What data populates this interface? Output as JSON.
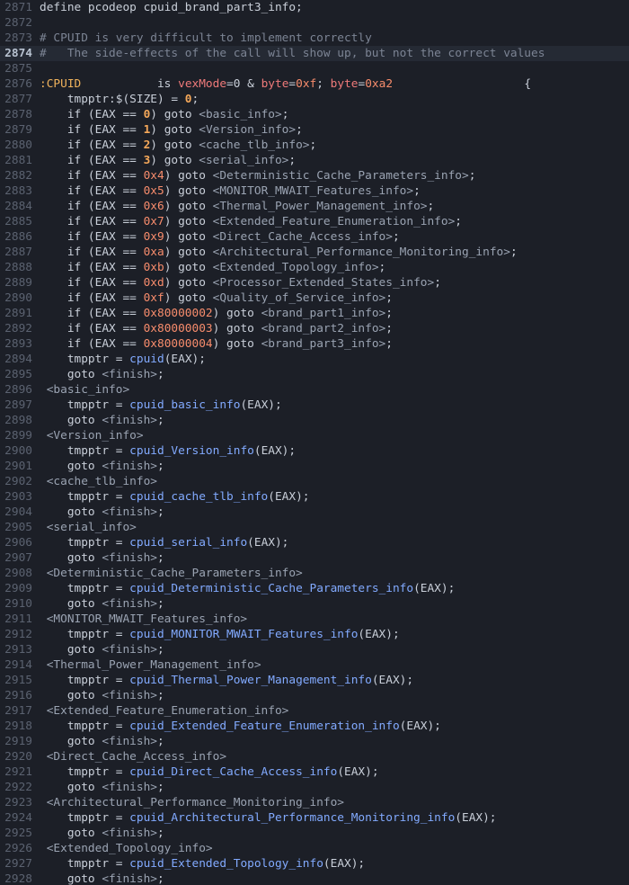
{
  "lines": [
    {
      "n": "2871",
      "t": [
        [
          "kw",
          "define pcodeop cpuid_brand_part3_info;"
        ]
      ]
    },
    {
      "n": "2872",
      "t": []
    },
    {
      "n": "2873",
      "t": [
        [
          "cm",
          "# CPUID is very difficult to implement correctly"
        ]
      ]
    },
    {
      "n": "2874",
      "current": true,
      "t": [
        [
          "cm",
          "#   The side-effects of the call will show up, but not the correct values"
        ]
      ]
    },
    {
      "n": "2875",
      "t": []
    },
    {
      "n": "2876",
      "t": [
        [
          "lbl",
          ":CPUID"
        ],
        [
          "pl",
          "           is "
        ],
        [
          "red",
          "vexMode"
        ],
        [
          "pl",
          "=0 & "
        ],
        [
          "red",
          "byte"
        ],
        [
          "pl",
          "="
        ],
        [
          "num",
          "0xf"
        ],
        [
          "pl",
          "; "
        ],
        [
          "red",
          "byte"
        ],
        [
          "pl",
          "="
        ],
        [
          "num",
          "0xa2"
        ],
        [
          "pl",
          "                   {"
        ]
      ]
    },
    {
      "n": "2877",
      "t": [
        [
          "pl",
          "    tmpptr:$(SIZE) = "
        ],
        [
          "numb",
          "0"
        ],
        [
          "pl",
          ";"
        ]
      ]
    },
    {
      "n": "2878",
      "t": [
        [
          "pl",
          "    if (EAX == "
        ],
        [
          "numb",
          "0"
        ],
        [
          "pl",
          ") goto "
        ],
        [
          "lb",
          "<basic_info>"
        ],
        [
          "pl",
          ";"
        ]
      ]
    },
    {
      "n": "2879",
      "t": [
        [
          "pl",
          "    if (EAX == "
        ],
        [
          "numb",
          "1"
        ],
        [
          "pl",
          ") goto "
        ],
        [
          "lb",
          "<Version_info>"
        ],
        [
          "pl",
          ";"
        ]
      ]
    },
    {
      "n": "2880",
      "t": [
        [
          "pl",
          "    if (EAX == "
        ],
        [
          "numb",
          "2"
        ],
        [
          "pl",
          ") goto "
        ],
        [
          "lb",
          "<cache_tlb_info>"
        ],
        [
          "pl",
          ";"
        ]
      ]
    },
    {
      "n": "2881",
      "t": [
        [
          "pl",
          "    if (EAX == "
        ],
        [
          "numb",
          "3"
        ],
        [
          "pl",
          ") goto "
        ],
        [
          "lb",
          "<serial_info>"
        ],
        [
          "pl",
          ";"
        ]
      ]
    },
    {
      "n": "2882",
      "t": [
        [
          "pl",
          "    if (EAX == "
        ],
        [
          "num",
          "0x4"
        ],
        [
          "pl",
          ") goto "
        ],
        [
          "lb",
          "<Deterministic_Cache_Parameters_info>"
        ],
        [
          "pl",
          ";"
        ]
      ]
    },
    {
      "n": "2883",
      "t": [
        [
          "pl",
          "    if (EAX == "
        ],
        [
          "num",
          "0x5"
        ],
        [
          "pl",
          ") goto "
        ],
        [
          "lb",
          "<MONITOR_MWAIT_Features_info>"
        ],
        [
          "pl",
          ";"
        ]
      ]
    },
    {
      "n": "2884",
      "t": [
        [
          "pl",
          "    if (EAX == "
        ],
        [
          "num",
          "0x6"
        ],
        [
          "pl",
          ") goto "
        ],
        [
          "lb",
          "<Thermal_Power_Management_info>"
        ],
        [
          "pl",
          ";"
        ]
      ]
    },
    {
      "n": "2885",
      "t": [
        [
          "pl",
          "    if (EAX == "
        ],
        [
          "num",
          "0x7"
        ],
        [
          "pl",
          ") goto "
        ],
        [
          "lb",
          "<Extended_Feature_Enumeration_info>"
        ],
        [
          "pl",
          ";"
        ]
      ]
    },
    {
      "n": "2886",
      "t": [
        [
          "pl",
          "    if (EAX == "
        ],
        [
          "num",
          "0x9"
        ],
        [
          "pl",
          ") goto "
        ],
        [
          "lb",
          "<Direct_Cache_Access_info>"
        ],
        [
          "pl",
          ";"
        ]
      ]
    },
    {
      "n": "2887",
      "t": [
        [
          "pl",
          "    if (EAX == "
        ],
        [
          "num",
          "0xa"
        ],
        [
          "pl",
          ") goto "
        ],
        [
          "lb",
          "<Architectural_Performance_Monitoring_info>"
        ],
        [
          "pl",
          ";"
        ]
      ]
    },
    {
      "n": "2888",
      "t": [
        [
          "pl",
          "    if (EAX == "
        ],
        [
          "num",
          "0xb"
        ],
        [
          "pl",
          ") goto "
        ],
        [
          "lb",
          "<Extended_Topology_info>"
        ],
        [
          "pl",
          ";"
        ]
      ]
    },
    {
      "n": "2889",
      "t": [
        [
          "pl",
          "    if (EAX == "
        ],
        [
          "num",
          "0xd"
        ],
        [
          "pl",
          ") goto "
        ],
        [
          "lb",
          "<Processor_Extended_States_info>"
        ],
        [
          "pl",
          ";"
        ]
      ]
    },
    {
      "n": "2890",
      "t": [
        [
          "pl",
          "    if (EAX == "
        ],
        [
          "num",
          "0xf"
        ],
        [
          "pl",
          ") goto "
        ],
        [
          "lb",
          "<Quality_of_Service_info>"
        ],
        [
          "pl",
          ";"
        ]
      ]
    },
    {
      "n": "2891",
      "t": [
        [
          "pl",
          "    if (EAX == "
        ],
        [
          "num",
          "0x80000002"
        ],
        [
          "pl",
          ") goto "
        ],
        [
          "lb",
          "<brand_part1_info>"
        ],
        [
          "pl",
          ";"
        ]
      ]
    },
    {
      "n": "2892",
      "t": [
        [
          "pl",
          "    if (EAX == "
        ],
        [
          "num",
          "0x80000003"
        ],
        [
          "pl",
          ") goto "
        ],
        [
          "lb",
          "<brand_part2_info>"
        ],
        [
          "pl",
          ";"
        ]
      ]
    },
    {
      "n": "2893",
      "t": [
        [
          "pl",
          "    if (EAX == "
        ],
        [
          "num",
          "0x80000004"
        ],
        [
          "pl",
          ") goto "
        ],
        [
          "lb",
          "<brand_part3_info>"
        ],
        [
          "pl",
          ";"
        ]
      ]
    },
    {
      "n": "2894",
      "t": [
        [
          "pl",
          "    tmpptr = "
        ],
        [
          "fn",
          "cpuid"
        ],
        [
          "pl",
          "(EAX);"
        ]
      ]
    },
    {
      "n": "2895",
      "t": [
        [
          "pl",
          "    goto "
        ],
        [
          "lb",
          "<finish>"
        ],
        [
          "pl",
          ";"
        ]
      ]
    },
    {
      "n": "2896",
      "t": [
        [
          "lb",
          " <basic_info>"
        ]
      ]
    },
    {
      "n": "2897",
      "t": [
        [
          "pl",
          "    tmpptr = "
        ],
        [
          "fn",
          "cpuid_basic_info"
        ],
        [
          "pl",
          "(EAX);"
        ]
      ]
    },
    {
      "n": "2898",
      "t": [
        [
          "pl",
          "    goto "
        ],
        [
          "lb",
          "<finish>"
        ],
        [
          "pl",
          ";"
        ]
      ]
    },
    {
      "n": "2899",
      "t": [
        [
          "lb",
          " <Version_info>"
        ]
      ]
    },
    {
      "n": "2900",
      "t": [
        [
          "pl",
          "    tmpptr = "
        ],
        [
          "fn",
          "cpuid_Version_info"
        ],
        [
          "pl",
          "(EAX);"
        ]
      ]
    },
    {
      "n": "2901",
      "t": [
        [
          "pl",
          "    goto "
        ],
        [
          "lb",
          "<finish>"
        ],
        [
          "pl",
          ";"
        ]
      ]
    },
    {
      "n": "2902",
      "t": [
        [
          "lb",
          " <cache_tlb_info>"
        ]
      ]
    },
    {
      "n": "2903",
      "t": [
        [
          "pl",
          "    tmpptr = "
        ],
        [
          "fn",
          "cpuid_cache_tlb_info"
        ],
        [
          "pl",
          "(EAX);"
        ]
      ]
    },
    {
      "n": "2904",
      "t": [
        [
          "pl",
          "    goto "
        ],
        [
          "lb",
          "<finish>"
        ],
        [
          "pl",
          ";"
        ]
      ]
    },
    {
      "n": "2905",
      "t": [
        [
          "lb",
          " <serial_info>"
        ]
      ]
    },
    {
      "n": "2906",
      "t": [
        [
          "pl",
          "    tmpptr = "
        ],
        [
          "fn",
          "cpuid_serial_info"
        ],
        [
          "pl",
          "(EAX);"
        ]
      ]
    },
    {
      "n": "2907",
      "t": [
        [
          "pl",
          "    goto "
        ],
        [
          "lb",
          "<finish>"
        ],
        [
          "pl",
          ";"
        ]
      ]
    },
    {
      "n": "2908",
      "t": [
        [
          "lb",
          " <Deterministic_Cache_Parameters_info>"
        ]
      ]
    },
    {
      "n": "2909",
      "t": [
        [
          "pl",
          "    tmpptr = "
        ],
        [
          "fn",
          "cpuid_Deterministic_Cache_Parameters_info"
        ],
        [
          "pl",
          "(EAX);"
        ]
      ]
    },
    {
      "n": "2910",
      "t": [
        [
          "pl",
          "    goto "
        ],
        [
          "lb",
          "<finish>"
        ],
        [
          "pl",
          ";"
        ]
      ]
    },
    {
      "n": "2911",
      "t": [
        [
          "lb",
          " <MONITOR_MWAIT_Features_info>"
        ]
      ]
    },
    {
      "n": "2912",
      "t": [
        [
          "pl",
          "    tmpptr = "
        ],
        [
          "fn",
          "cpuid_MONITOR_MWAIT_Features_info"
        ],
        [
          "pl",
          "(EAX);"
        ]
      ]
    },
    {
      "n": "2913",
      "t": [
        [
          "pl",
          "    goto "
        ],
        [
          "lb",
          "<finish>"
        ],
        [
          "pl",
          ";"
        ]
      ]
    },
    {
      "n": "2914",
      "t": [
        [
          "lb",
          " <Thermal_Power_Management_info>"
        ]
      ]
    },
    {
      "n": "2915",
      "t": [
        [
          "pl",
          "    tmpptr = "
        ],
        [
          "fn",
          "cpuid_Thermal_Power_Management_info"
        ],
        [
          "pl",
          "(EAX);"
        ]
      ]
    },
    {
      "n": "2916",
      "t": [
        [
          "pl",
          "    goto "
        ],
        [
          "lb",
          "<finish>"
        ],
        [
          "pl",
          ";"
        ]
      ]
    },
    {
      "n": "2917",
      "t": [
        [
          "lb",
          " <Extended_Feature_Enumeration_info>"
        ]
      ]
    },
    {
      "n": "2918",
      "t": [
        [
          "pl",
          "    tmpptr = "
        ],
        [
          "fn",
          "cpuid_Extended_Feature_Enumeration_info"
        ],
        [
          "pl",
          "(EAX);"
        ]
      ]
    },
    {
      "n": "2919",
      "t": [
        [
          "pl",
          "    goto "
        ],
        [
          "lb",
          "<finish>"
        ],
        [
          "pl",
          ";"
        ]
      ]
    },
    {
      "n": "2920",
      "t": [
        [
          "lb",
          " <Direct_Cache_Access_info>"
        ]
      ]
    },
    {
      "n": "2921",
      "t": [
        [
          "pl",
          "    tmpptr = "
        ],
        [
          "fn",
          "cpuid_Direct_Cache_Access_info"
        ],
        [
          "pl",
          "(EAX);"
        ]
      ]
    },
    {
      "n": "2922",
      "t": [
        [
          "pl",
          "    goto "
        ],
        [
          "lb",
          "<finish>"
        ],
        [
          "pl",
          ";"
        ]
      ]
    },
    {
      "n": "2923",
      "t": [
        [
          "lb",
          " <Architectural_Performance_Monitoring_info>"
        ]
      ]
    },
    {
      "n": "2924",
      "t": [
        [
          "pl",
          "    tmpptr = "
        ],
        [
          "fn",
          "cpuid_Architectural_Performance_Monitoring_info"
        ],
        [
          "pl",
          "(EAX);"
        ]
      ]
    },
    {
      "n": "2925",
      "t": [
        [
          "pl",
          "    goto "
        ],
        [
          "lb",
          "<finish>"
        ],
        [
          "pl",
          ";"
        ]
      ]
    },
    {
      "n": "2926",
      "t": [
        [
          "lb",
          " <Extended_Topology_info>"
        ]
      ]
    },
    {
      "n": "2927",
      "t": [
        [
          "pl",
          "    tmpptr = "
        ],
        [
          "fn",
          "cpuid_Extended_Topology_info"
        ],
        [
          "pl",
          "(EAX);"
        ]
      ]
    },
    {
      "n": "2928",
      "t": [
        [
          "pl",
          "    goto "
        ],
        [
          "lb",
          "<finish>"
        ],
        [
          "pl",
          ";"
        ]
      ]
    }
  ]
}
